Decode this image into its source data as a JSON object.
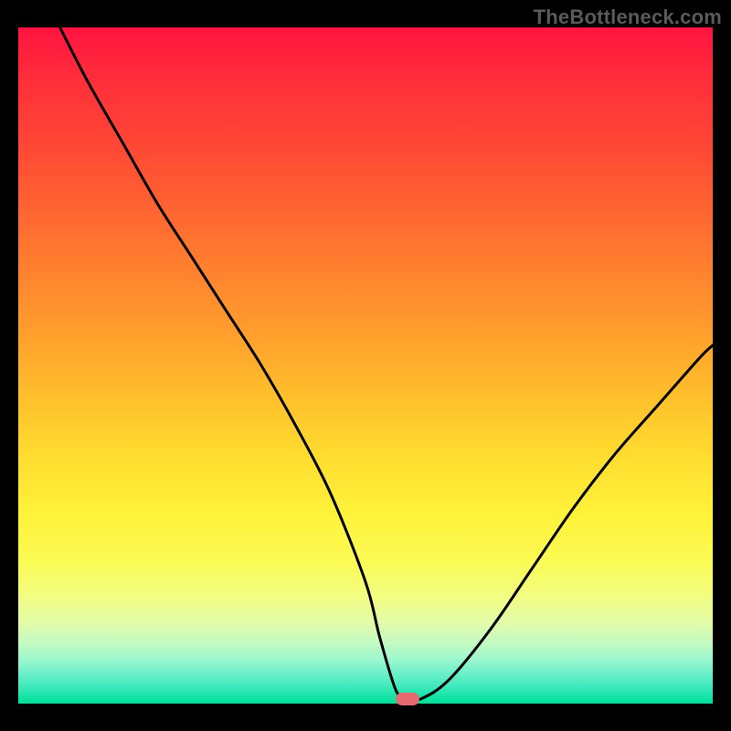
{
  "watermark": "TheBottleneck.com",
  "chart_data": {
    "type": "line",
    "title": "",
    "xlabel": "",
    "ylabel": "",
    "xlim": [
      0,
      100
    ],
    "ylim": [
      0,
      100
    ],
    "series": [
      {
        "name": "curve",
        "x": [
          6,
          10,
          15,
          20,
          25,
          30,
          35,
          40,
          45,
          50,
          52,
          54,
          55,
          56,
          58,
          62,
          68,
          74,
          80,
          86,
          92,
          98,
          100
        ],
        "values": [
          100,
          92,
          83,
          74,
          66,
          58,
          50,
          41,
          31,
          18,
          10,
          3,
          1,
          0.7,
          0.7,
          3.5,
          11,
          20,
          29,
          37,
          44,
          51,
          53
        ]
      }
    ],
    "marker": {
      "x": 56,
      "y": 0.7,
      "color": "#e46a6f"
    },
    "gradient_stops": [
      {
        "pct": 0,
        "color": "#ff1340"
      },
      {
        "pct": 50,
        "color": "#ffc42c"
      },
      {
        "pct": 80,
        "color": "#fbfb55"
      },
      {
        "pct": 100,
        "color": "#00e09a"
      }
    ]
  }
}
